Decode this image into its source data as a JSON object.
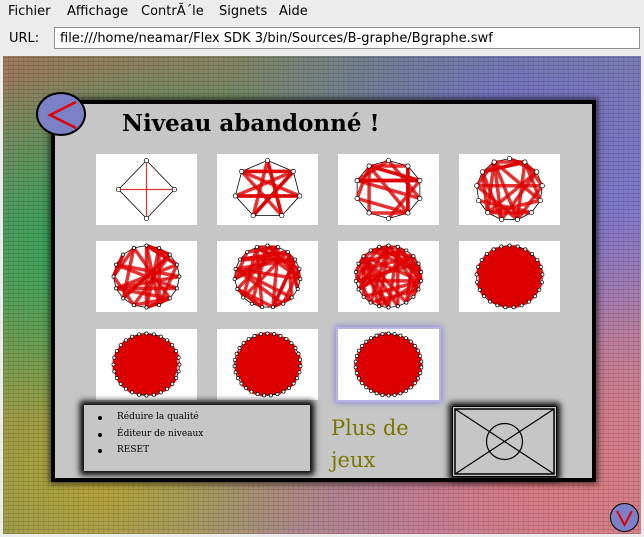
{
  "menubar": {
    "items": [
      "Fichier",
      "Affichage",
      "ContrÃ´le",
      "Signets",
      "Aide"
    ]
  },
  "urlbar": {
    "label": "URL:",
    "value": "file:///home/neamar/Flex SDK 3/bin/Sources/B-graphe/Bgraphe.swf"
  },
  "game": {
    "title": "Niveau abandonné !",
    "options": [
      "Réduire la qualité",
      "Éditeur de niveaux",
      "RESET"
    ],
    "more_games": "Plus de jeux",
    "levels_count": 11,
    "selected_level": 11
  },
  "colors": {
    "panel": "#c6c6c6",
    "button": "#7c80c6",
    "edge": "#dd0000",
    "accent_text": "#7a7500"
  }
}
